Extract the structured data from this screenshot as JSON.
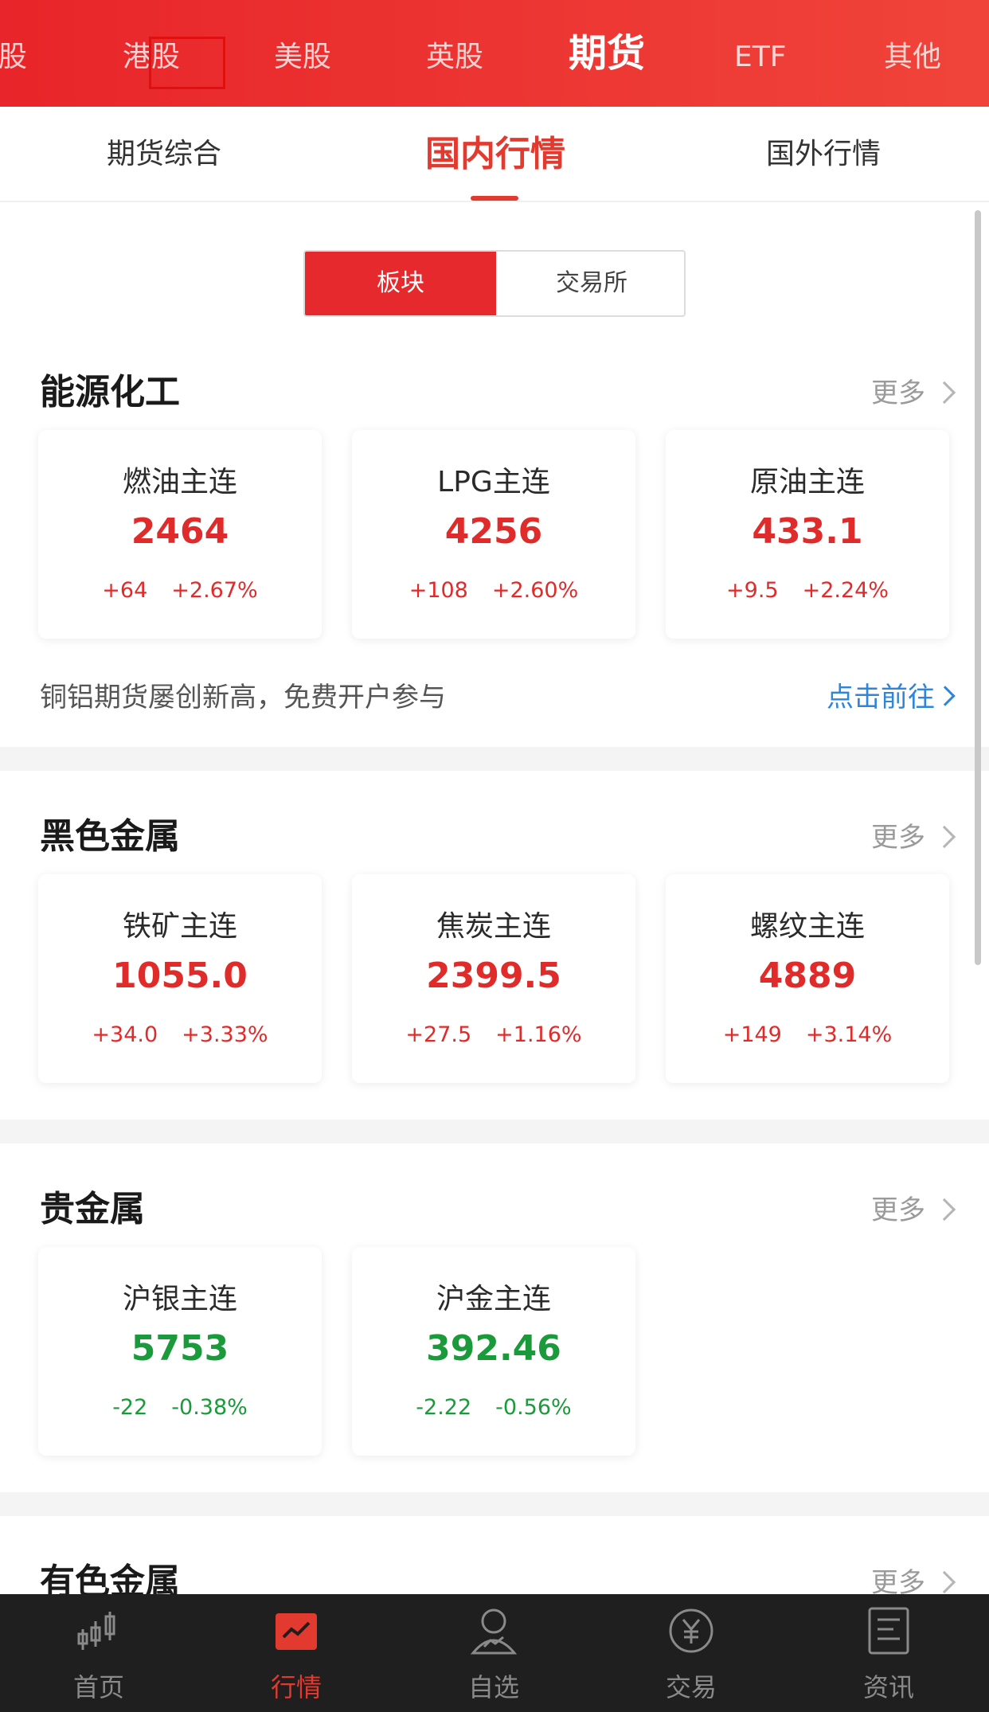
{
  "top_tabs": [
    {
      "label": "股"
    },
    {
      "label": "港股"
    },
    {
      "label": "美股"
    },
    {
      "label": "英股"
    },
    {
      "label": "期货"
    },
    {
      "label": "ETF"
    },
    {
      "label": "其他"
    }
  ],
  "sub_tabs": [
    {
      "label": "期货综合"
    },
    {
      "label": "国内行情"
    },
    {
      "label": "国外行情"
    }
  ],
  "segment": {
    "active": "板块",
    "inactive": "交易所"
  },
  "more_label": "更多",
  "sections": [
    {
      "title": "能源化工",
      "cards": [
        {
          "name": "燃油主连",
          "price": "2464",
          "change": "+64",
          "pct": "+2.67%",
          "direction": "up"
        },
        {
          "name": "LPG主连",
          "price": "4256",
          "change": "+108",
          "pct": "+2.60%",
          "direction": "up"
        },
        {
          "name": "原油主连",
          "price": "433.1",
          "change": "+9.5",
          "pct": "+2.24%",
          "direction": "up"
        }
      ]
    },
    {
      "title": "黑色金属",
      "cards": [
        {
          "name": "铁矿主连",
          "price": "1055.0",
          "change": "+34.0",
          "pct": "+3.33%",
          "direction": "up"
        },
        {
          "name": "焦炭主连",
          "price": "2399.5",
          "change": "+27.5",
          "pct": "+1.16%",
          "direction": "up"
        },
        {
          "name": "螺纹主连",
          "price": "4889",
          "change": "+149",
          "pct": "+3.14%",
          "direction": "up"
        }
      ]
    },
    {
      "title": "贵金属",
      "cards": [
        {
          "name": "沪银主连",
          "price": "5753",
          "change": "-22",
          "pct": "-0.38%",
          "direction": "down"
        },
        {
          "name": "沪金主连",
          "price": "392.46",
          "change": "-2.22",
          "pct": "-0.56%",
          "direction": "down"
        }
      ]
    },
    {
      "title": "有色金属",
      "cards": []
    }
  ],
  "promo": {
    "text": "铜铝期货屡创新高，免费开户参与",
    "link": "点击前往"
  },
  "bottom_nav": [
    {
      "label": "首页",
      "icon": "candlestick-icon"
    },
    {
      "label": "行情",
      "icon": "market-chart-icon"
    },
    {
      "label": "自选",
      "icon": "watchlist-user-icon"
    },
    {
      "label": "交易",
      "icon": "yuan-coin-icon"
    },
    {
      "label": "资讯",
      "icon": "news-document-icon"
    }
  ],
  "colors": {
    "brand_red": "#e6292c",
    "up": "#e02b2b",
    "down": "#1a9a3a",
    "link_blue": "#2f86d8"
  }
}
